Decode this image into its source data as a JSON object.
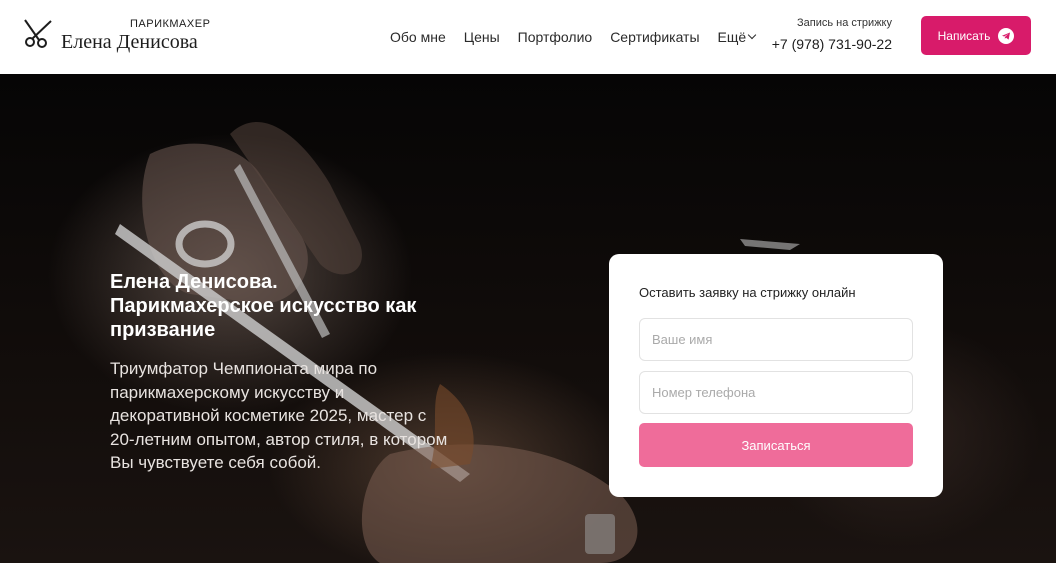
{
  "header": {
    "logo_subtitle": "ПАРИКМАХЕР",
    "logo_title": "Елена Денисова",
    "nav": [
      {
        "label": "Обо мне"
      },
      {
        "label": "Цены"
      },
      {
        "label": "Портфолио"
      },
      {
        "label": "Сертификаты"
      },
      {
        "label": "Ещё"
      }
    ],
    "contact_label": "Запись на стрижку",
    "phone": "+7 (978) 731-90-22",
    "write_label": "Написать",
    "accent_color": "#d81b6a"
  },
  "hero": {
    "title_line1": "Елена Денисова.",
    "title_line2": "Парикмахерское искусство как призвание",
    "description": "Триумфатор Чемпионата мира по парикмахерскому искусству и декоративной косметике 2025, мастер с 20-летним опытом, автор стиля, в котором Вы чувствуете себя собой."
  },
  "form": {
    "title": "Оставить заявку на стрижку онлайн",
    "name_placeholder": "Ваше имя",
    "phone_placeholder": "Номер телефона",
    "submit_label": "Записаться",
    "submit_color": "#ef6c9a"
  }
}
